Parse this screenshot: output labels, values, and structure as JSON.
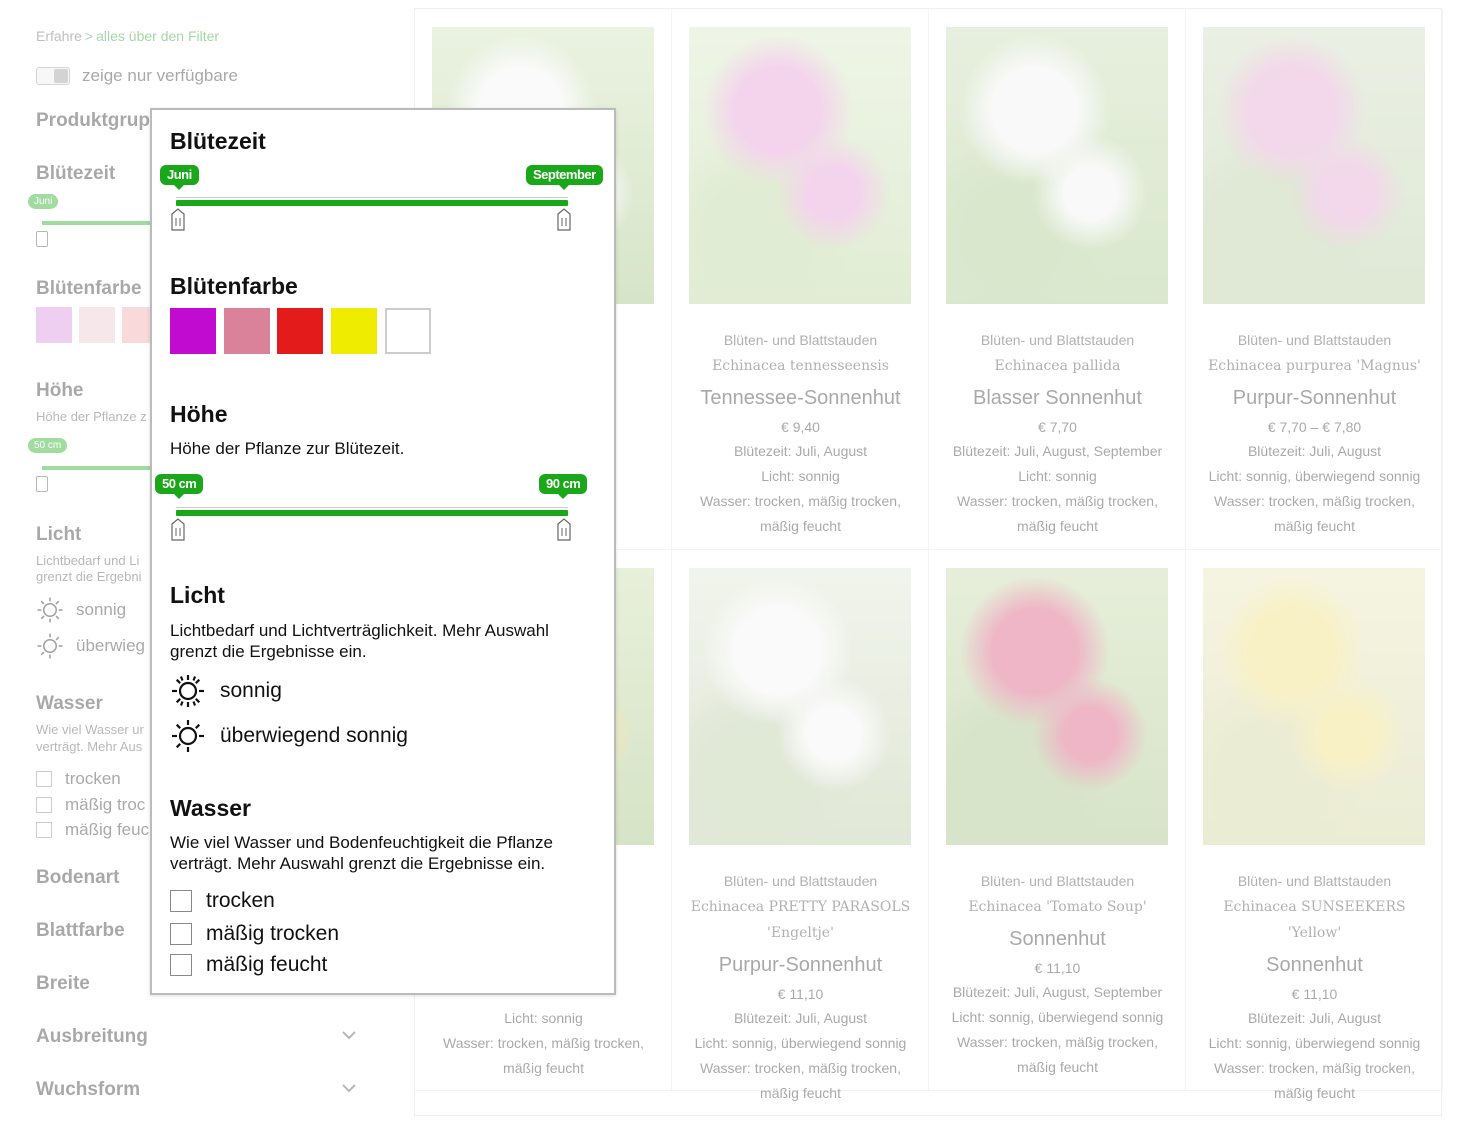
{
  "breadcrumb": {
    "prefix": "Erfahre",
    "separator": ">",
    "link": "alles über den Filter"
  },
  "availability_toggle": {
    "label": "zeige nur verfügbare"
  },
  "sidebar": {
    "produktgruppe": "Produktgrup",
    "bluetezeit": "Blütezeit",
    "bluetezeit_pill": "Juni",
    "bluetenfarbe": "Blütenfarbe",
    "hoehe": "Höhe",
    "hoehe_sub": "Höhe der Pflanze z",
    "hoehe_pill": "50 cm",
    "licht": "Licht",
    "licht_sub1": "Lichtbedarf und Li",
    "licht_sub2": "grenzt die Ergebni",
    "licht_opt1": "sonnig",
    "licht_opt2": "überwieg",
    "wasser": "Wasser",
    "wasser_sub1": "Wie viel Wasser ur",
    "wasser_sub2": "verträgt. Mehr Aus",
    "wasser_opt1": "trocken",
    "wasser_opt2": "mäßig troc",
    "wasser_opt3": "mäßig feuc",
    "bodenart": "Bodenart",
    "blattfarbe": "Blattfarbe",
    "breite": "Breite",
    "ausbreitung": "Ausbreitung",
    "wuchsform": "Wuchsform",
    "swatch_colors": [
      "#d98be0",
      "#e8c8cf",
      "#f2a7a7"
    ]
  },
  "panel": {
    "bluetezeit": {
      "title": "Blütezeit",
      "min_label": "Juni",
      "max_label": "September"
    },
    "bluetenfarbe": {
      "title": "Blütenfarbe",
      "colors": [
        "#c10bd0",
        "#d9829a",
        "#e31b1b",
        "#f0ec00",
        "#ffffff"
      ]
    },
    "hoehe": {
      "title": "Höhe",
      "description": "Höhe der Pflanze zur Blütezeit.",
      "min_label": "50 cm",
      "max_label": "90 cm"
    },
    "licht": {
      "title": "Licht",
      "description": "Lichtbedarf und Lichtverträglichkeit. Mehr Auswahl grenzt die Ergebnisse ein.",
      "options": [
        "sonnig",
        "überwiegend sonnig"
      ],
      "icons": [
        "sun-icon",
        "sun-partial-icon"
      ]
    },
    "wasser": {
      "title": "Wasser",
      "description": "Wie viel Wasser und Bodenfeuchtigkeit die Pflanze verträgt. Mehr Auswahl grenzt die Ergebnisse ein.",
      "options": [
        "trocken",
        "mäßig trocken",
        "mäßig feucht"
      ]
    }
  },
  "products": [
    {
      "category": "",
      "latin": "",
      "name": "",
      "price": "",
      "bloom": "",
      "light": "",
      "water1": "",
      "water2": ""
    },
    {
      "category": "Blüten- und Blattstauden",
      "latin": "Echinacea tennesseensis",
      "name": "Tennessee-Sonnenhut",
      "price": "€ 9,40",
      "bloom": "Blütezeit: Juli, August",
      "light": "Licht: sonnig",
      "water1": "Wasser: trocken, mäßig trocken,",
      "water2": "mäßig feucht"
    },
    {
      "category": "Blüten- und Blattstauden",
      "latin": "Echinacea pallida",
      "name": "Blasser Sonnenhut",
      "price": "€ 7,70",
      "bloom": "Blütezeit: Juli, August, September",
      "light": "Licht: sonnig",
      "water1": "Wasser: trocken, mäßig trocken,",
      "water2": "mäßig feucht"
    },
    {
      "category": "Blüten- und Blattstauden",
      "latin": "Echinacea purpurea 'Magnus'",
      "name": "Purpur-Sonnenhut",
      "price": "€ 7,70 – € 7,80",
      "bloom": "Blütezeit: Juli, August",
      "light": "Licht: sonnig, überwiegend sonnig",
      "water1": "Wasser: trocken, mäßig trocken,",
      "water2": "mäßig feucht"
    },
    {
      "category": "",
      "latin": "",
      "name": "",
      "price": "",
      "bloom": "",
      "light": "Licht: sonnig",
      "water1": "Wasser: trocken, mäßig trocken,",
      "water2": "mäßig feucht"
    },
    {
      "category": "Blüten- und Blattstauden",
      "latin": "Echinacea PRETTY PARASOLS 'Engeltje'",
      "name": "Purpur-Sonnenhut",
      "price": "€ 11,10",
      "bloom": "Blütezeit: Juli, August",
      "light": "Licht: sonnig, überwiegend sonnig",
      "water1": "Wasser: trocken, mäßig trocken,",
      "water2": "mäßig feucht"
    },
    {
      "category": "Blüten- und Blattstauden",
      "latin": "Echinacea 'Tomato Soup'",
      "name": "Sonnenhut",
      "price": "€ 11,10",
      "bloom": "Blütezeit: Juli, August, September",
      "light": "Licht: sonnig, überwiegend sonnig",
      "water1": "Wasser: trocken, mäßig trocken,",
      "water2": "mäßig feucht"
    },
    {
      "category": "Blüten- und Blattstauden",
      "latin": "Echinacea SUNSEEKERS 'Yellow'",
      "name": "Sonnenhut",
      "price": "€ 11,10",
      "bloom": "Blütezeit: Juli, August",
      "light": "Licht: sonnig, überwiegend sonnig",
      "water1": "Wasser: trocken, mäßig trocken,",
      "water2": "mäßig feucht"
    }
  ],
  "image_palettes": [
    [
      "#cfe3b8",
      "#f4f4f4",
      "#9fc27e"
    ],
    [
      "#d9e8c6",
      "#e79ad4",
      "#b9d49a"
    ],
    [
      "#c8dcb2",
      "#f2f2f2",
      "#a6c98a"
    ],
    [
      "#cfdcbf",
      "#e4a2cf",
      "#b4cb9d"
    ],
    [
      "#c9dca8",
      "#e6c35a",
      "#9fbf7a"
    ],
    [
      "#dfe6d3",
      "#f5f5f5",
      "#b7c9a0"
    ],
    [
      "#c6d9a8",
      "#d9547a",
      "#a1c07f"
    ],
    [
      "#e9e6b8",
      "#f1e07a",
      "#d0d49a"
    ]
  ]
}
